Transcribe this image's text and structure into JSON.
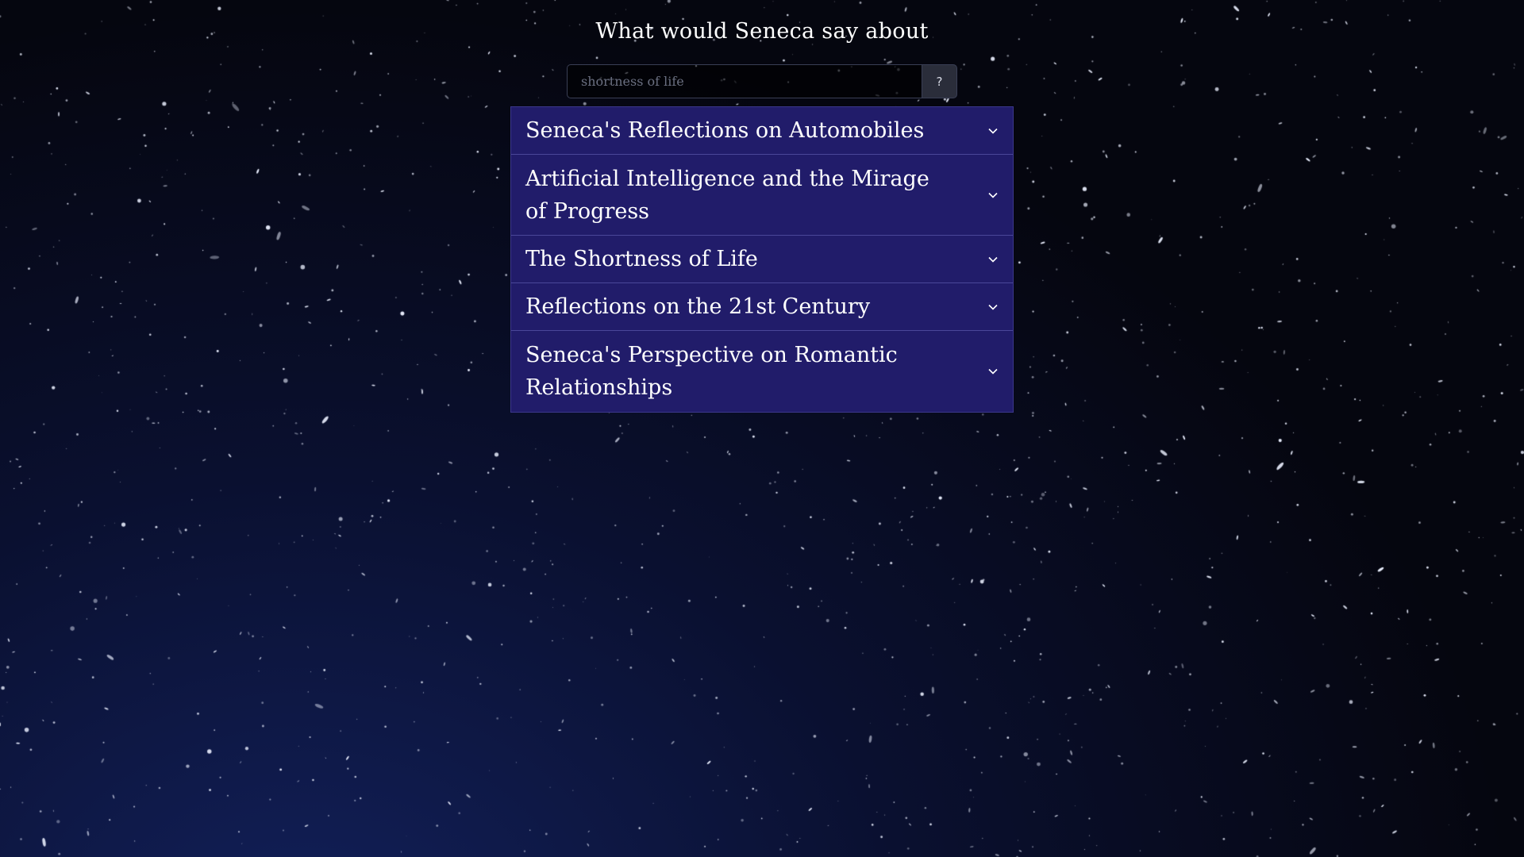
{
  "page": {
    "heading": "What would Seneca say about"
  },
  "search": {
    "placeholder": "shortness of life",
    "value": "",
    "button_label": "?"
  },
  "accordion": {
    "items": [
      {
        "title": "Seneca's Reflections on Automobiles",
        "icon": "chevron-down-icon"
      },
      {
        "title": "Artificial Intelligence and the Mirage of Progress",
        "icon": "chevron-down-icon"
      },
      {
        "title": "The Shortness of Life",
        "icon": "chevron-down-icon"
      },
      {
        "title": "Reflections on the 21st Century",
        "icon": "chevron-down-icon"
      },
      {
        "title": "Seneca's Perspective on Romantic Relationships",
        "icon": "chevron-down-icon"
      }
    ]
  },
  "colors": {
    "accordion_bg": "#211c6a",
    "accordion_divider": "#4a4799",
    "page_bg": "#05060f",
    "text": "#ffffff"
  }
}
